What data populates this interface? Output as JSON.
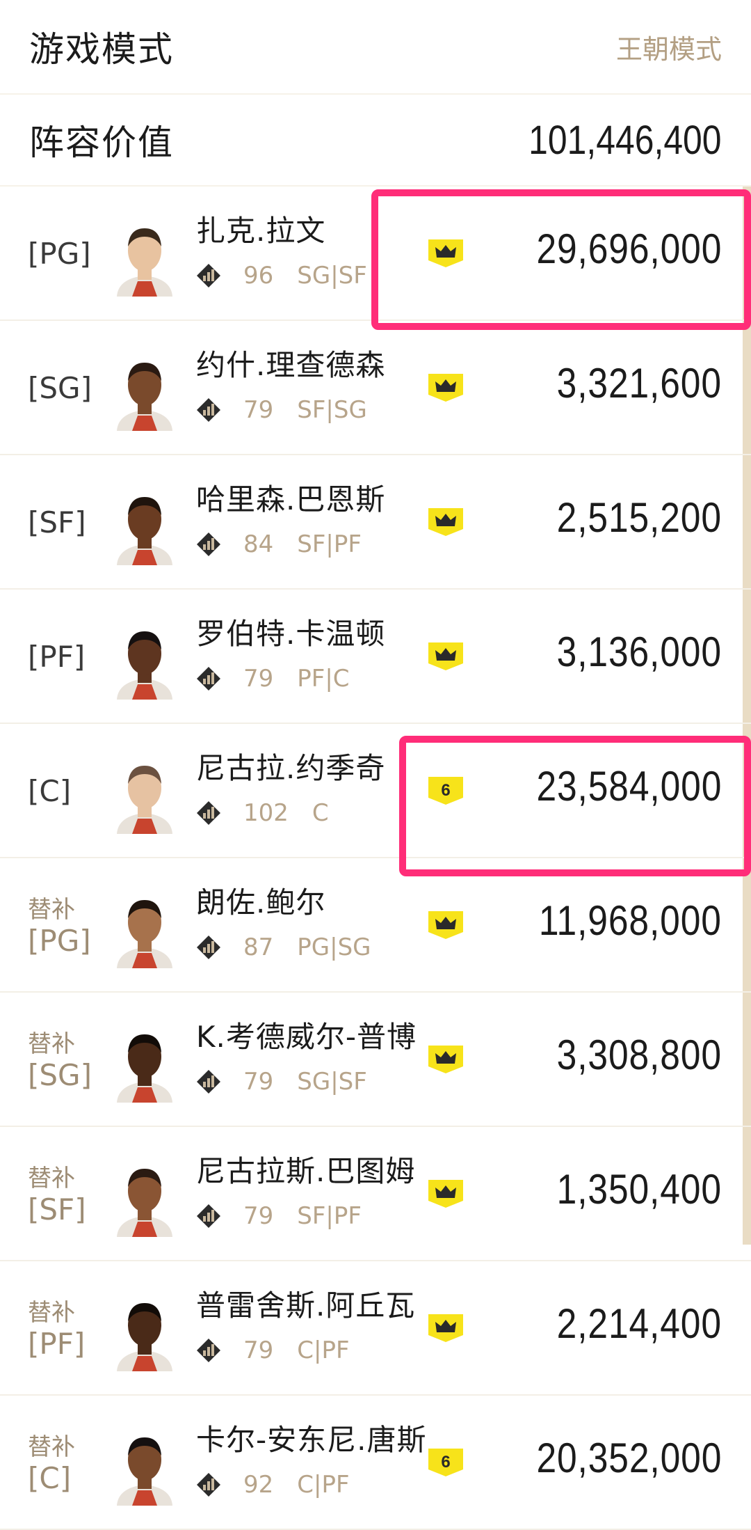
{
  "game_mode": {
    "label": "游戏模式",
    "value": "王朝模式"
  },
  "roster_value": {
    "label": "阵容价值",
    "value": "101,446,400"
  },
  "players": [
    {
      "sub": "",
      "pos": "[PG]",
      "name": "扎克.拉文",
      "rating": "96",
      "positions": "SG|SF",
      "badge": "crown",
      "salary": "29,696,000",
      "skin": "#e8c3a0",
      "hair": "#3a2a1c"
    },
    {
      "sub": "",
      "pos": "[SG]",
      "name": "约什.理查德森",
      "rating": "79",
      "positions": "SF|SG",
      "badge": "crown",
      "salary": "3,321,600",
      "skin": "#7a4a2c",
      "hair": "#2a1a12"
    },
    {
      "sub": "",
      "pos": "[SF]",
      "name": "哈里森.巴恩斯",
      "rating": "84",
      "positions": "SF|PF",
      "badge": "crown",
      "salary": "2,515,200",
      "skin": "#6a3c22",
      "hair": "#1f140d"
    },
    {
      "sub": "",
      "pos": "[PF]",
      "name": "罗伯特.卡温顿",
      "rating": "79",
      "positions": "PF|C",
      "badge": "crown",
      "salary": "3,136,000",
      "skin": "#5e3520",
      "hair": "#151010"
    },
    {
      "sub": "",
      "pos": "[C]",
      "name": "尼古拉.约季奇",
      "rating": "102",
      "positions": "C",
      "badge": "6",
      "salary": "23,584,000",
      "skin": "#e6c2a2",
      "hair": "#6b5140"
    },
    {
      "sub": "替补",
      "pos": "[PG]",
      "name": "朗佐.鲍尔",
      "rating": "87",
      "positions": "PG|SG",
      "badge": "crown",
      "salary": "11,968,000",
      "skin": "#a7724c",
      "hair": "#1f140d"
    },
    {
      "sub": "替补",
      "pos": "[SG]",
      "name": "K.考德威尔-普博",
      "rating": "79",
      "positions": "SG|SF",
      "badge": "crown",
      "salary": "3,308,800",
      "skin": "#4a2a18",
      "hair": "#120c08"
    },
    {
      "sub": "替补",
      "pos": "[SF]",
      "name": "尼古拉斯.巴图姆",
      "rating": "79",
      "positions": "SF|PF",
      "badge": "crown",
      "salary": "1,350,400",
      "skin": "#8a5534",
      "hair": "#2a1a12"
    },
    {
      "sub": "替补",
      "pos": "[PF]",
      "name": "普雷舍斯.阿丘瓦",
      "rating": "79",
      "positions": "C|PF",
      "badge": "crown",
      "salary": "2,214,400",
      "skin": "#4a2a18",
      "hair": "#120c08"
    },
    {
      "sub": "替补",
      "pos": "[C]",
      "name": "卡尔-安东尼.唐斯",
      "rating": "92",
      "positions": "C|PF",
      "badge": "6",
      "salary": "20,352,000",
      "skin": "#7a4a2c",
      "hair": "#151010"
    }
  ],
  "colors": {
    "accent_gold": "#b39f83",
    "badge_yellow": "#f7e31a",
    "highlight_pink": "#ff2d78"
  },
  "icons": {
    "badge": "crown-icon",
    "rating": "rating-bars-icon"
  }
}
